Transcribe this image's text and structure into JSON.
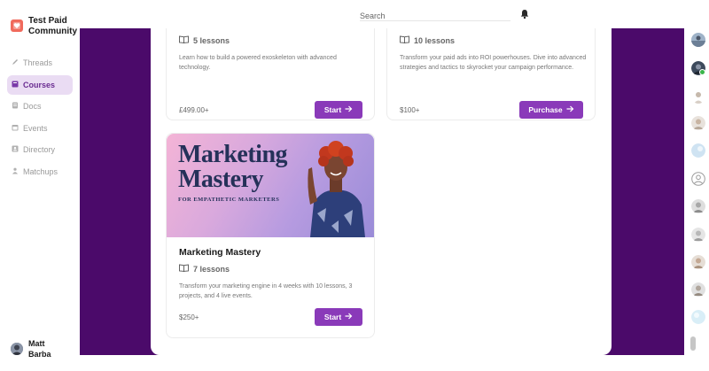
{
  "brand": {
    "name": "Test Paid Community"
  },
  "nav": {
    "items": [
      {
        "label": "Threads",
        "icon": "pencil-icon",
        "active": false
      },
      {
        "label": "Courses",
        "icon": "book-icon",
        "active": true
      },
      {
        "label": "Docs",
        "icon": "document-icon",
        "active": false
      },
      {
        "label": "Events",
        "icon": "calendar-icon",
        "active": false
      },
      {
        "label": "Directory",
        "icon": "directory-icon",
        "active": false
      },
      {
        "label": "Matchups",
        "icon": "matchups-icon",
        "active": false
      }
    ]
  },
  "user": {
    "name": "Matt Barba"
  },
  "search": {
    "placeholder": "Search"
  },
  "colors": {
    "accent": "#8a3ab9",
    "backdrop": "#4b0a6a",
    "nav_active_bg": "#eadcf3"
  },
  "courses": [
    {
      "lessons": "5 lessons",
      "description": "Learn how to build a powered exoskeleton with advanced technology.",
      "price": "£499.00+",
      "action": "Start"
    },
    {
      "lessons": "10 lessons",
      "description": "Transform your paid ads into ROI powerhouses. Dive into advanced strategies and tactics to skyrocket your campaign performance.",
      "price": "$100+",
      "action": "Purchase"
    },
    {
      "thumb_title": "Marketing Mastery",
      "thumb_subtitle": "FOR EMPATHETIC MARKETERS",
      "title": "Marketing Mastery",
      "lessons": "7 lessons",
      "description": "Transform your marketing engine in 4 weeks with 10 lessons, 3 projects, and 4 live events.",
      "price": "$250+",
      "action": "Start"
    }
  ]
}
